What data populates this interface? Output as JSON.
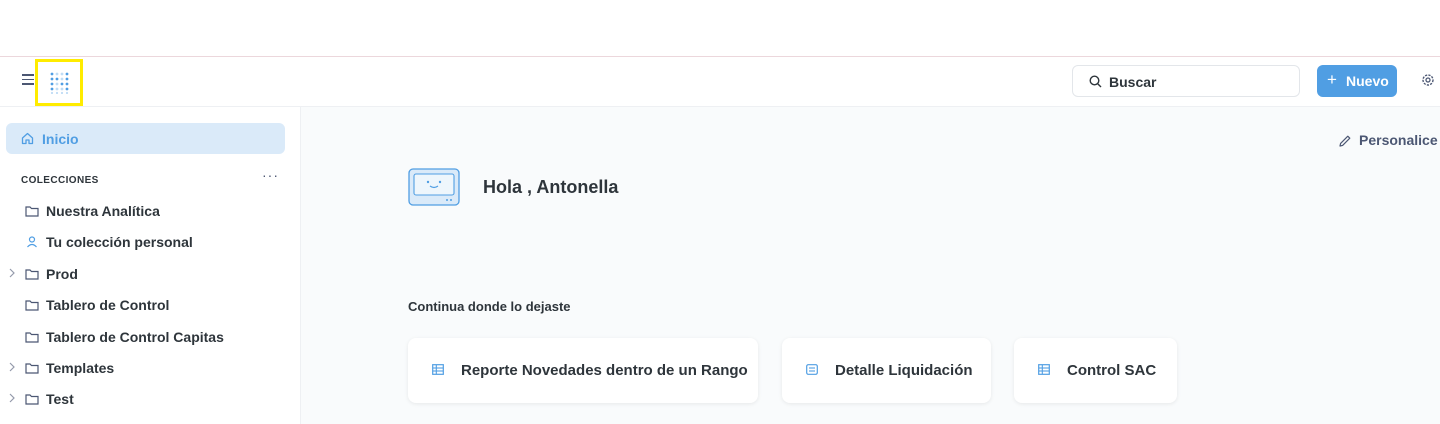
{
  "navbar": {
    "search_placeholder": "Buscar",
    "new_button_plus": "+",
    "new_button_label": "Nuevo",
    "accent_color": "#509ee3",
    "highlight_color": "#ffec00"
  },
  "sidebar": {
    "home_label": "Inicio",
    "collections_heading": "COLECCIONES",
    "collections_more": "···",
    "items": [
      {
        "label": "Nuestra Analítica",
        "icon": "folder-icon",
        "expandable": false
      },
      {
        "label": "Tu colección personal",
        "icon": "person-icon",
        "expandable": false
      },
      {
        "label": "Prod",
        "icon": "folder-icon",
        "expandable": true
      },
      {
        "label": "Tablero de Control",
        "icon": "folder-icon",
        "expandable": false
      },
      {
        "label": "Tablero de Control Capitas",
        "icon": "folder-icon",
        "expandable": false
      },
      {
        "label": "Templates",
        "icon": "folder-icon",
        "expandable": true
      },
      {
        "label": "Test",
        "icon": "folder-icon",
        "expandable": true
      }
    ]
  },
  "main": {
    "personalize_label": "Personalice",
    "greeting": "Hola , Antonella",
    "continue_heading": "Continua donde lo dejaste",
    "recent_items": [
      {
        "label": "Reporte Novedades dentro de un Rango",
        "icon": "table-icon"
      },
      {
        "label": "Detalle Liquidación",
        "icon": "list-icon"
      },
      {
        "label": "Control SAC",
        "icon": "table-icon"
      }
    ]
  }
}
